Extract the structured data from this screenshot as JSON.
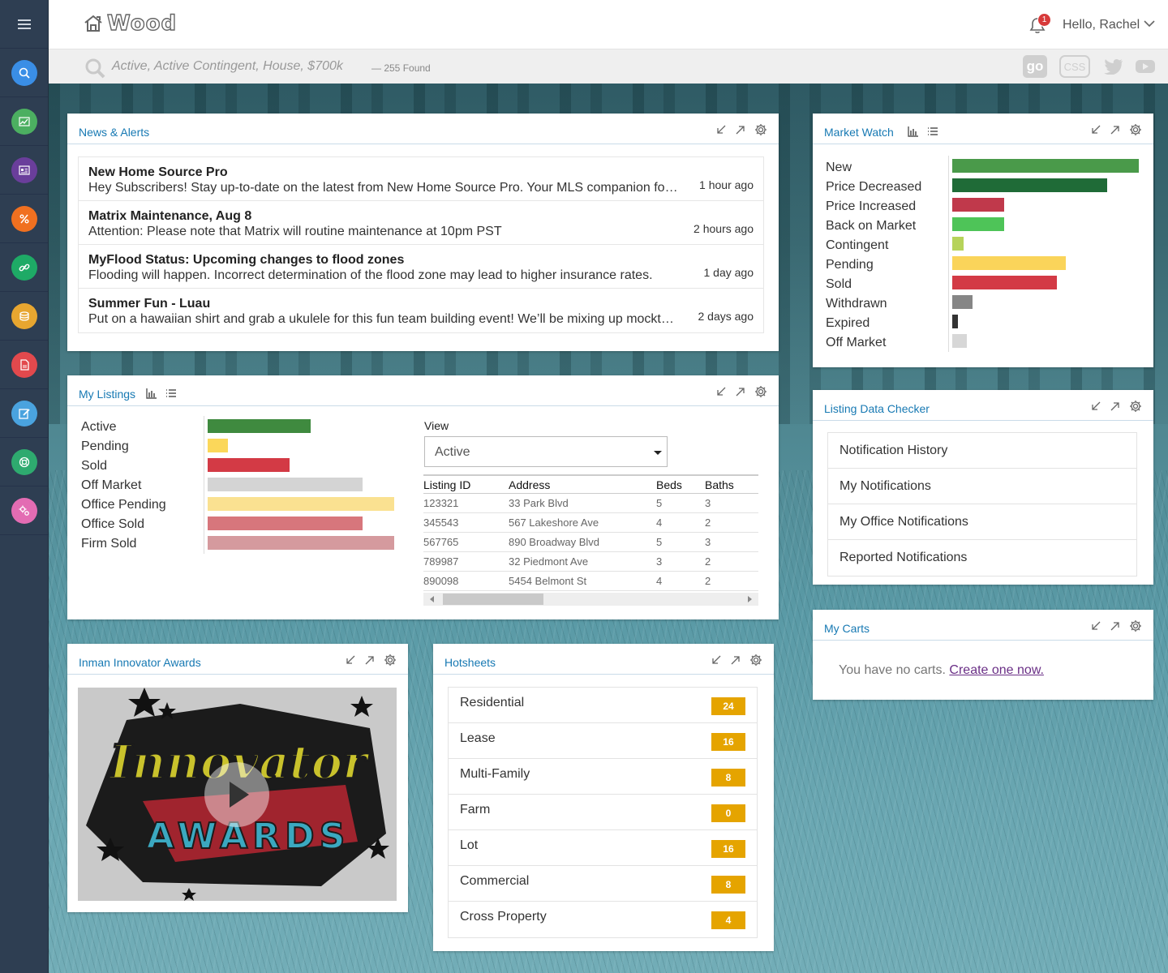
{
  "app": {
    "logo": "Wood",
    "greeting": "Hello, Rachel",
    "notif_count": "1"
  },
  "search": {
    "query": "Active, Active Contingent, House, $700k",
    "found": "—  255 Found",
    "social": [
      "go",
      "CSS",
      "twitter-icon",
      "youtube-icon"
    ]
  },
  "sidebar": {
    "items": [
      "search-icon",
      "trend-icon",
      "card-icon",
      "percent-icon",
      "link-icon",
      "coins-icon",
      "document-icon",
      "edit-icon",
      "support-icon",
      "settings-icon"
    ],
    "colors": [
      "#3a8ee6",
      "#4caf61",
      "#6a3e9b",
      "#f07020",
      "#1eaa66",
      "#e7a630",
      "#e2494d",
      "#4aa3df",
      "#2eaa6f",
      "#e36cb3"
    ]
  },
  "news": {
    "title": "News & Alerts",
    "items": [
      {
        "title": "New Home Source Pro",
        "body": "Hey Subscribers! Stay up-to-date on the latest from New Home Source Pro. Your MLS companion for new construction listings.",
        "time": "1 hour ago"
      },
      {
        "title": "Matrix Maintenance, Aug 8",
        "body": "Attention: Please note that Matrix will routine maintenance at 10pm PST",
        "time": "2 hours ago"
      },
      {
        "title": "MyFlood Status: Upcoming changes to flood zones",
        "body": "Flooding will happen. Incorrect determination of the flood zone may lead to higher insurance rates.",
        "time": "1 day ago"
      },
      {
        "title": "Summer Fun - Luau",
        "body": "Put on a hawaiian shirt and grab a ukulele for this fun team building event! We’ll be mixing up mocktails and more.",
        "time": "2 days ago"
      }
    ]
  },
  "market_watch": {
    "title": "Market Watch",
    "labels": [
      "New",
      "Price Decreased",
      "Price Increased",
      "Back on Market",
      "Contingent",
      "Pending",
      "Sold",
      "Withdrawn",
      "Expired",
      "Off Market"
    ],
    "values": [
      100,
      83,
      28,
      28,
      6,
      61,
      56,
      11,
      3,
      8
    ],
    "colors": [
      "#4a9a4a",
      "#1f6b37",
      "#c0394b",
      "#4ec458",
      "#b6d35a",
      "#fad45a",
      "#d33a45",
      "#868686",
      "#333333",
      "#d7d7d7"
    ]
  },
  "listings": {
    "title": "My Listings",
    "labels": [
      "Active",
      "Pending",
      "Sold",
      "Off Market",
      "Office Pending",
      "Office Sold",
      "Firm Sold"
    ],
    "values": [
      55,
      11,
      44,
      83,
      100,
      83,
      100
    ],
    "colors": [
      "#3f8a3f",
      "#fbd75a",
      "#d33a45",
      "#d4d4d4",
      "#fae191",
      "#d7767c",
      "#d59a9e"
    ],
    "view_label": "View",
    "view_value": "Active",
    "columns": [
      "Listing ID",
      "Address",
      "Beds",
      "Baths"
    ],
    "rows": [
      [
        "123321",
        "33 Park Blvd",
        "5",
        "3"
      ],
      [
        "345543",
        "567 Lakeshore Ave",
        "4",
        "2"
      ],
      [
        "567765",
        "890 Broadway Blvd",
        "5",
        "3"
      ],
      [
        "789987",
        "32 Piedmont Ave",
        "3",
        "2"
      ],
      [
        "890098",
        "5454 Belmont St",
        "4",
        "2"
      ]
    ]
  },
  "data_checker": {
    "title": "Listing Data Checker",
    "items": [
      "Notification History",
      "My Notifications",
      "My Office Notifications",
      "Reported Notifications"
    ]
  },
  "carts": {
    "title": "My Carts",
    "text": "You have no carts.",
    "link": "Create one now."
  },
  "awards": {
    "title": "Inman Innovator Awards",
    "line1": "Innovator",
    "line2": "AWARDS"
  },
  "hotsheets": {
    "title": "Hotsheets",
    "items": [
      {
        "label": "Residential",
        "count": "24"
      },
      {
        "label": "Lease",
        "count": "16"
      },
      {
        "label": "Multi-Family",
        "count": "8"
      },
      {
        "label": "Farm",
        "count": "0"
      },
      {
        "label": "Lot",
        "count": "16"
      },
      {
        "label": "Commercial",
        "count": "8"
      },
      {
        "label": "Cross Property",
        "count": "4"
      }
    ]
  }
}
